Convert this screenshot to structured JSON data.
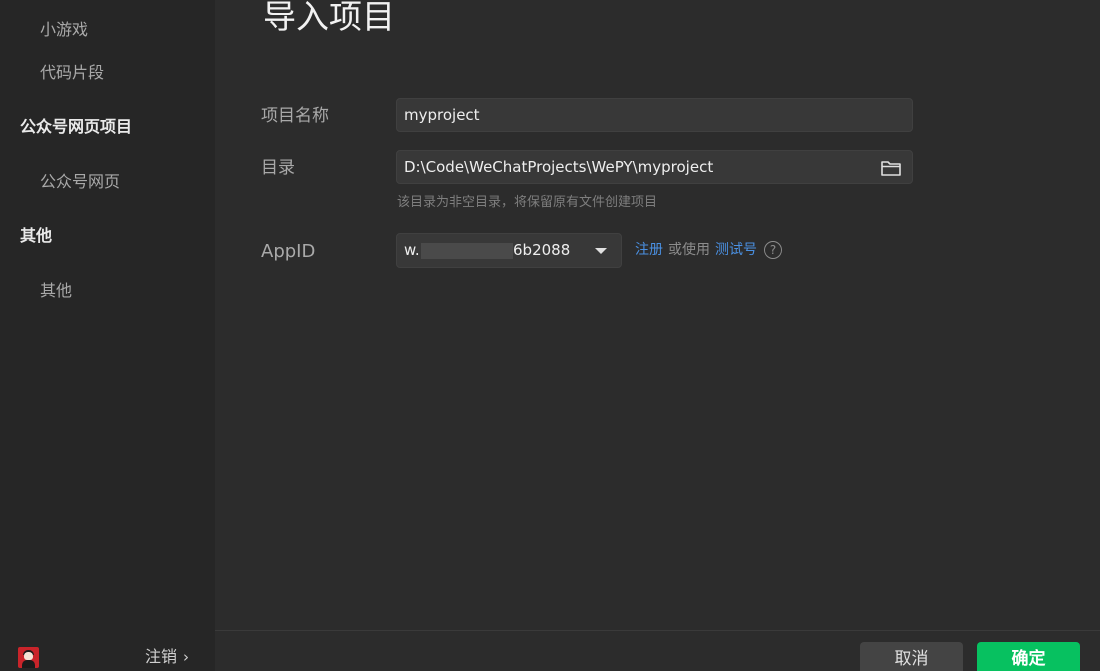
{
  "sidebar": {
    "minigame_label": "小游戏",
    "code_snippet_label": "代码片段",
    "oa_group_label": "公众号网页项目",
    "oa_webpage_label": "公众号网页",
    "other_group_label": "其他",
    "other_label": "其他",
    "logout_label": "注销",
    "logout_chevron": "›"
  },
  "page": {
    "title": "导入项目"
  },
  "form": {
    "name_label": "项目名称",
    "name_value": "myproject",
    "dir_label": "目录",
    "dir_value": "D:\\Code\\WeChatProjects\\WePY\\myproject",
    "dir_hint": "该目录为非空目录，将保留原有文件创建项目",
    "appid_label": "AppID",
    "appid_prefix": "w.",
    "appid_suffix": "6b2088",
    "register_link": "注册",
    "or_use": "或使用",
    "test_account_link": "测试号",
    "help_glyph": "?"
  },
  "footer": {
    "cancel_label": "取消",
    "ok_label": "确定"
  },
  "colors": {
    "accent_green": "#07c160",
    "link_blue": "#4a90e2",
    "sidebar_bg": "#262626",
    "main_bg": "#2c2c2c"
  },
  "icons": [
    "folder-icon",
    "caret-down-icon",
    "help-icon",
    "avatar",
    "chevron-right-icon"
  ]
}
